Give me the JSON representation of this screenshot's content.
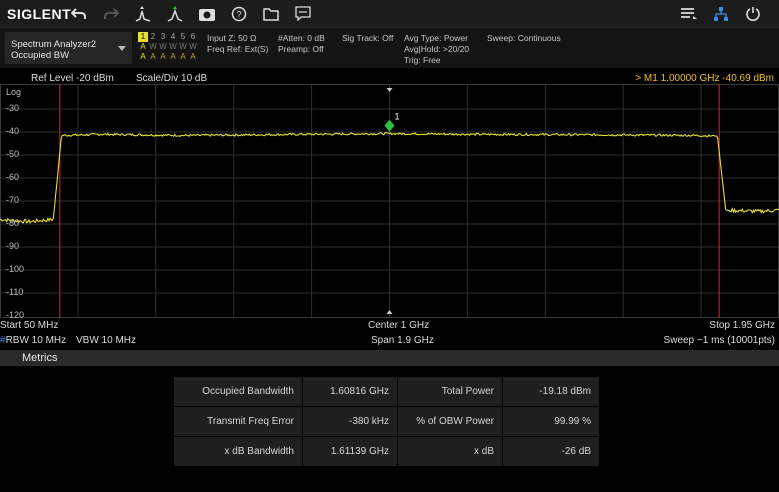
{
  "toolbar": {
    "brand": "SIGLENT"
  },
  "mode": {
    "line1": "Spectrum Analyzer2",
    "line2": "Occupied BW"
  },
  "traces": {
    "numbers": [
      "1",
      "2",
      "3",
      "4",
      "5",
      "6"
    ],
    "types": [
      "A",
      "W",
      "W",
      "W",
      "W",
      "W"
    ],
    "detectors": [
      "A",
      "A",
      "A",
      "A",
      "A",
      "A"
    ]
  },
  "status": {
    "input_z": "Input Z: 50 Ω",
    "freq_ref": "Freq Ref: Ext(S)",
    "atten": "#Atten: 0 dB",
    "preamp": "Preamp: Off",
    "sig_track": "Sig Track: Off",
    "avg_type": "Avg Type: Power",
    "avg_hold": "Avg|Hold: >20/20",
    "trig": "Trig: Free",
    "sweep_mode": "Sweep: Continuous"
  },
  "plot": {
    "ref_level": "Ref Level  -20 dBm",
    "scale_div": "Scale/Div  10 dB",
    "scale_type": "Log",
    "marker_readout": "> M1  1.00000 GHz  -40.69 dBm",
    "marker_label": "1",
    "y_ticks": [
      "-30",
      "-40",
      "-50",
      "-60",
      "-70",
      "-80",
      "-90",
      "-100",
      "-110",
      "-120"
    ],
    "start": "Start  50 MHz",
    "center": "Center  1 GHz",
    "stop": "Stop  1.95 GHz",
    "rbw": "RBW  10 MHz",
    "rbw_flag": "#",
    "vbw": "VBW  10 MHz",
    "span": "Span  1.9 GHz",
    "sweep": "Sweep  ~1 ms (10001pts)",
    "trace_color": "#e8e030",
    "obw_line_color": "#c83030",
    "marker_color": "#30c040"
  },
  "chart_data": {
    "type": "line",
    "series": [
      {
        "x_ghz": [
          0.05,
          0.12,
          0.18,
          0.2,
          0.3,
          0.5,
          0.8,
          1.0,
          1.2,
          1.5,
          1.75,
          1.8,
          1.82,
          1.9,
          1.95
        ],
        "y_dbm": [
          -78,
          -79,
          -78,
          -41.5,
          -41,
          -41.5,
          -41,
          -40.7,
          -41,
          -41.2,
          -41.5,
          -41.8,
          -74,
          -74.5,
          -74
        ]
      }
    ],
    "xlim": [
      0.05,
      1.95
    ],
    "ylim": [
      -120,
      -20
    ],
    "obw_edges_ghz": [
      0.1959,
      1.8041
    ],
    "marker": {
      "name": "M1",
      "x_ghz": 1.0,
      "y_dbm": -40.69
    }
  },
  "metrics": {
    "title": "Metrics",
    "rows": [
      [
        "Occupied Bandwidth",
        "1.60816 GHz",
        "Total Power",
        "-19.18 dBm"
      ],
      [
        "Transmit Freq Error",
        "-380 kHz",
        "% of OBW Power",
        "99.99 %"
      ],
      [
        "x dB Bandwidth",
        "1.61139 GHz",
        "x dB",
        "-26 dB"
      ]
    ]
  }
}
